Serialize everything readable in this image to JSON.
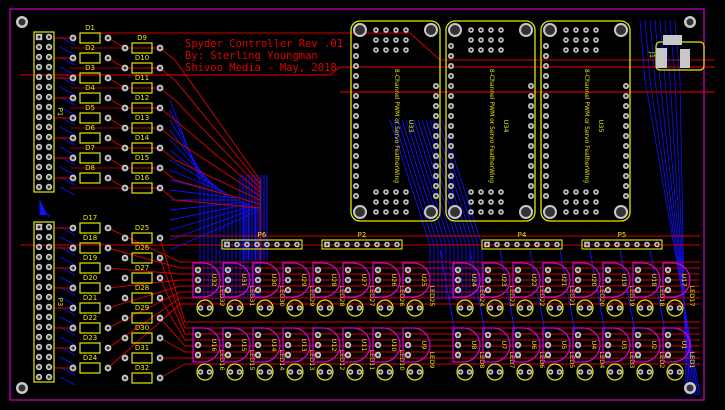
{
  "board": {
    "title_lines": [
      "Spyder Controller Rev .01",
      "By: Sterling Youngman",
      "Shivoo Media - May, 2018"
    ],
    "colors": {
      "background": "#000000",
      "outline": "#a000a0",
      "top_copper": "#d00000",
      "bottom_copper": "#1010ff",
      "silkscreen": "#e8e800",
      "pad": "#c8c8c8",
      "transistor_outline": "#d000d0",
      "copper_fill": "#8a0000"
    }
  },
  "headers": {
    "p1": "P1",
    "p3": "P3",
    "p6": "P6",
    "p2": "P2",
    "p4": "P4",
    "p5": "P5",
    "j1": "J1"
  },
  "diodes": {
    "col1_top": [
      "D1",
      "D2",
      "D3",
      "D4",
      "D5",
      "D6",
      "D7",
      "D8"
    ],
    "col2_top": [
      "D9",
      "D10",
      "D11",
      "D12",
      "D13",
      "D14",
      "D15",
      "D16"
    ],
    "col1_bottom": [
      "D17",
      "D18",
      "D19",
      "D20",
      "D21",
      "D22",
      "D23",
      "D24"
    ],
    "col2_bottom": [
      "D25",
      "D26",
      "D27",
      "D28",
      "D29",
      "D30",
      "D31",
      "D32"
    ]
  },
  "featherwings": [
    {
      "ref": "U33",
      "name": "8-Channel PWM or Servo FeatherWing"
    },
    {
      "ref": "U34",
      "name": "8-Channel PWM or Servo FeatherWing"
    },
    {
      "ref": "U35",
      "name": "8-Channel PWM or Servo FeatherWing"
    }
  ],
  "transistor_rows": {
    "left_top": {
      "u": [
        "U32",
        "U31",
        "U30",
        "U29",
        "U28",
        "U27",
        "U26",
        "U25"
      ],
      "led": [
        "LED32",
        "LED31",
        "LED30",
        "LED29",
        "LED28",
        "LED27",
        "LED26",
        "LED25"
      ]
    },
    "left_bottom": {
      "u": [
        "U16",
        "U15",
        "U14",
        "U13",
        "U12",
        "U11",
        "U10",
        "U9"
      ],
      "led": [
        "LED16",
        "LED15",
        "LED14",
        "LED13",
        "LED12",
        "LED11",
        "LED10",
        "LED9"
      ]
    },
    "right_top": {
      "u": [
        "U24",
        "U23",
        "U22",
        "U21",
        "U20",
        "U19",
        "U18",
        "U17"
      ],
      "led": [
        "LED24",
        "LED23",
        "LED22",
        "LED21",
        "LED20",
        "LED19",
        "LED18",
        "LED17"
      ]
    },
    "right_bottom": {
      "u": [
        "U8",
        "U7",
        "U6",
        "U5",
        "U4",
        "U3",
        "U2",
        "U1"
      ],
      "led": [
        "LED8",
        "LED7",
        "LED6",
        "LED5",
        "LED4",
        "LED3",
        "LED2",
        "LED1"
      ]
    }
  }
}
